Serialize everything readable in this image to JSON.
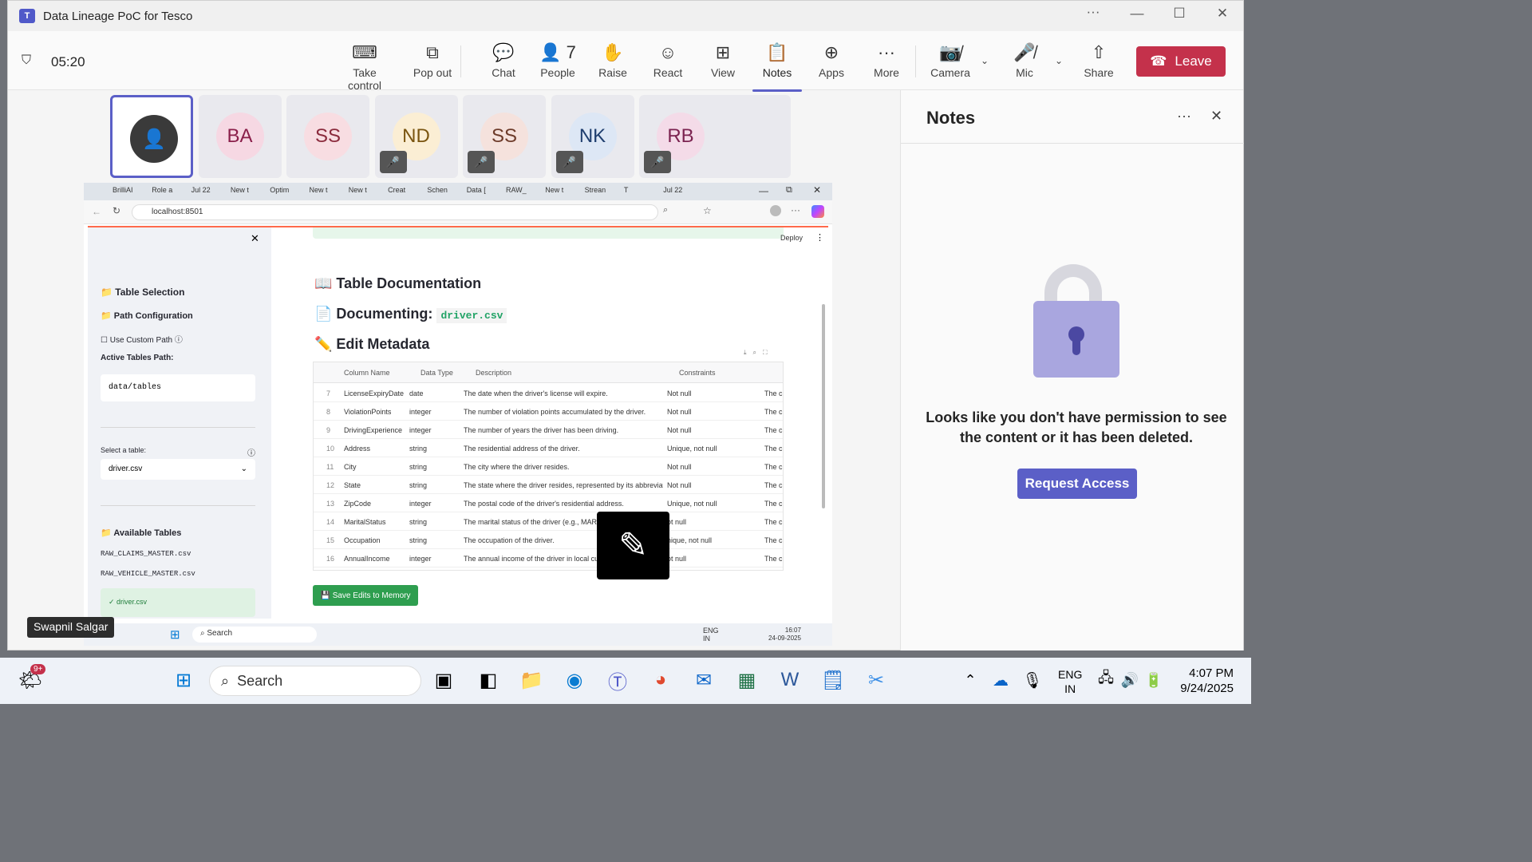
{
  "window": {
    "title": "Data Lineage PoC for Tesco",
    "logo": "T"
  },
  "meeting": {
    "timer": "05:20",
    "toolbar": [
      {
        "label": "Take control",
        "icon": "take-control-icon",
        "glyph": "⌨"
      },
      {
        "label": "Pop out",
        "icon": "pop-out-icon",
        "glyph": "⧉"
      },
      {
        "label": "Chat",
        "icon": "chat-icon",
        "glyph": "💬"
      },
      {
        "label": "People",
        "icon": "people-icon",
        "glyph": "👤",
        "count": "7"
      },
      {
        "label": "Raise",
        "icon": "raise-hand-icon",
        "glyph": "✋"
      },
      {
        "label": "React",
        "icon": "react-icon",
        "glyph": "☺"
      },
      {
        "label": "View",
        "icon": "view-icon",
        "glyph": "⊞"
      },
      {
        "label": "Notes",
        "icon": "notes-icon",
        "glyph": "📋"
      },
      {
        "label": "Apps",
        "icon": "apps-icon",
        "glyph": "⊕"
      },
      {
        "label": "More",
        "icon": "more-icon",
        "glyph": "···"
      }
    ],
    "camera_label": "Camera",
    "mic_label": "Mic",
    "share_label": "Share",
    "leave_label": "Leave"
  },
  "participants": [
    {
      "initials": "",
      "photo": true,
      "muted": false
    },
    {
      "initials": "BA",
      "color": "#f6d8e3",
      "text": "#8a1f4a",
      "muted": false
    },
    {
      "initials": "SS",
      "color": "#f8dde2",
      "text": "#8a2a3c",
      "muted": false
    },
    {
      "initials": "ND",
      "color": "#fbeed4",
      "text": "#7a5510",
      "muted": true
    },
    {
      "initials": "SS",
      "color": "#f5e2dd",
      "text": "#6d3b2a",
      "muted": true
    },
    {
      "initials": "NK",
      "color": "#dde7f5",
      "text": "#1f3e6e",
      "muted": true
    },
    {
      "initials": "RB",
      "color": "#f4dbe8",
      "text": "#7b2350",
      "muted": true
    }
  ],
  "browser": {
    "tabs": [
      "BrilliAI",
      "Role a",
      "Jul 22",
      "New t",
      "Optim",
      "New t",
      "New t",
      "Creat",
      "Schen",
      "Data [",
      "RAW_",
      "New t",
      "Strean",
      "T",
      "Jul 22"
    ],
    "url": "localhost:8501"
  },
  "streamlit": {
    "deploy": "Deploy",
    "sidebar": {
      "table_selection": "Table Selection",
      "path_configuration": "Path Configuration",
      "use_custom_path": "Use Custom Path",
      "active_tables_path_label": "Active Tables Path:",
      "active_tables_path": "data/tables",
      "select_table_label": "Select a table:",
      "select_table_value": "driver.csv",
      "available_tables": "Available Tables",
      "tables": [
        "RAW_CLAIMS_MASTER.csv",
        "RAW_VEHICLE_MASTER.csv"
      ],
      "selected_table": "✓ driver.csv"
    },
    "main": {
      "table_documentation": "Table Documentation",
      "documenting_label": "Documenting:",
      "documenting_file": "driver.csv",
      "edit_metadata": "Edit Metadata",
      "columns": [
        "Column Name",
        "Data Type",
        "Description",
        "Constraints"
      ],
      "rows": [
        [
          "7",
          "LicenseExpiryDate",
          "date",
          "The date when the driver's license will expire.",
          "Not null",
          "The c"
        ],
        [
          "8",
          "ViolationPoints",
          "integer",
          "The number of violation points accumulated by the driver.",
          "Not null",
          "The c"
        ],
        [
          "9",
          "DrivingExperience",
          "integer",
          "The number of years the driver has been driving.",
          "Not null",
          "The c"
        ],
        [
          "10",
          "Address",
          "string",
          "The residential address of the driver.",
          "Unique, not null",
          "The c"
        ],
        [
          "11",
          "City",
          "string",
          "The city where the driver resides.",
          "Not null",
          "The c"
        ],
        [
          "12",
          "State",
          "string",
          "The state where the driver resides, represented by its abbreviatio",
          "Not null",
          "The c"
        ],
        [
          "13",
          "ZipCode",
          "integer",
          "The postal code of the driver's residential address.",
          "Unique, not null",
          "The c"
        ],
        [
          "14",
          "MaritalStatus",
          "string",
          "The marital status of the driver (e.g., MARRI",
          "ot null",
          "The c"
        ],
        [
          "15",
          "Occupation",
          "string",
          "The occupation of the driver.",
          "nique, not null",
          "The c"
        ],
        [
          "16",
          "AnnualIncome",
          "integer",
          "The annual income of the driver in local curr",
          "ot null",
          "The c"
        ]
      ],
      "save_button": "💾 Save Edits to Memory"
    }
  },
  "inner_taskbar": {
    "search": "Search",
    "lang1": "ENG",
    "lang2": "IN",
    "time": "16:07",
    "date": "24-09-2025"
  },
  "presenter_name": "Swapnil Salgar",
  "notes": {
    "title": "Notes",
    "message": "Looks like you don't have permission to see the content or it has been deleted.",
    "request_access": "Request Access"
  },
  "taskbar": {
    "search": "Search",
    "notification_badge": "9+",
    "lang1": "ENG",
    "lang2": "IN",
    "time": "4:07 PM",
    "date": "9/24/2025"
  }
}
